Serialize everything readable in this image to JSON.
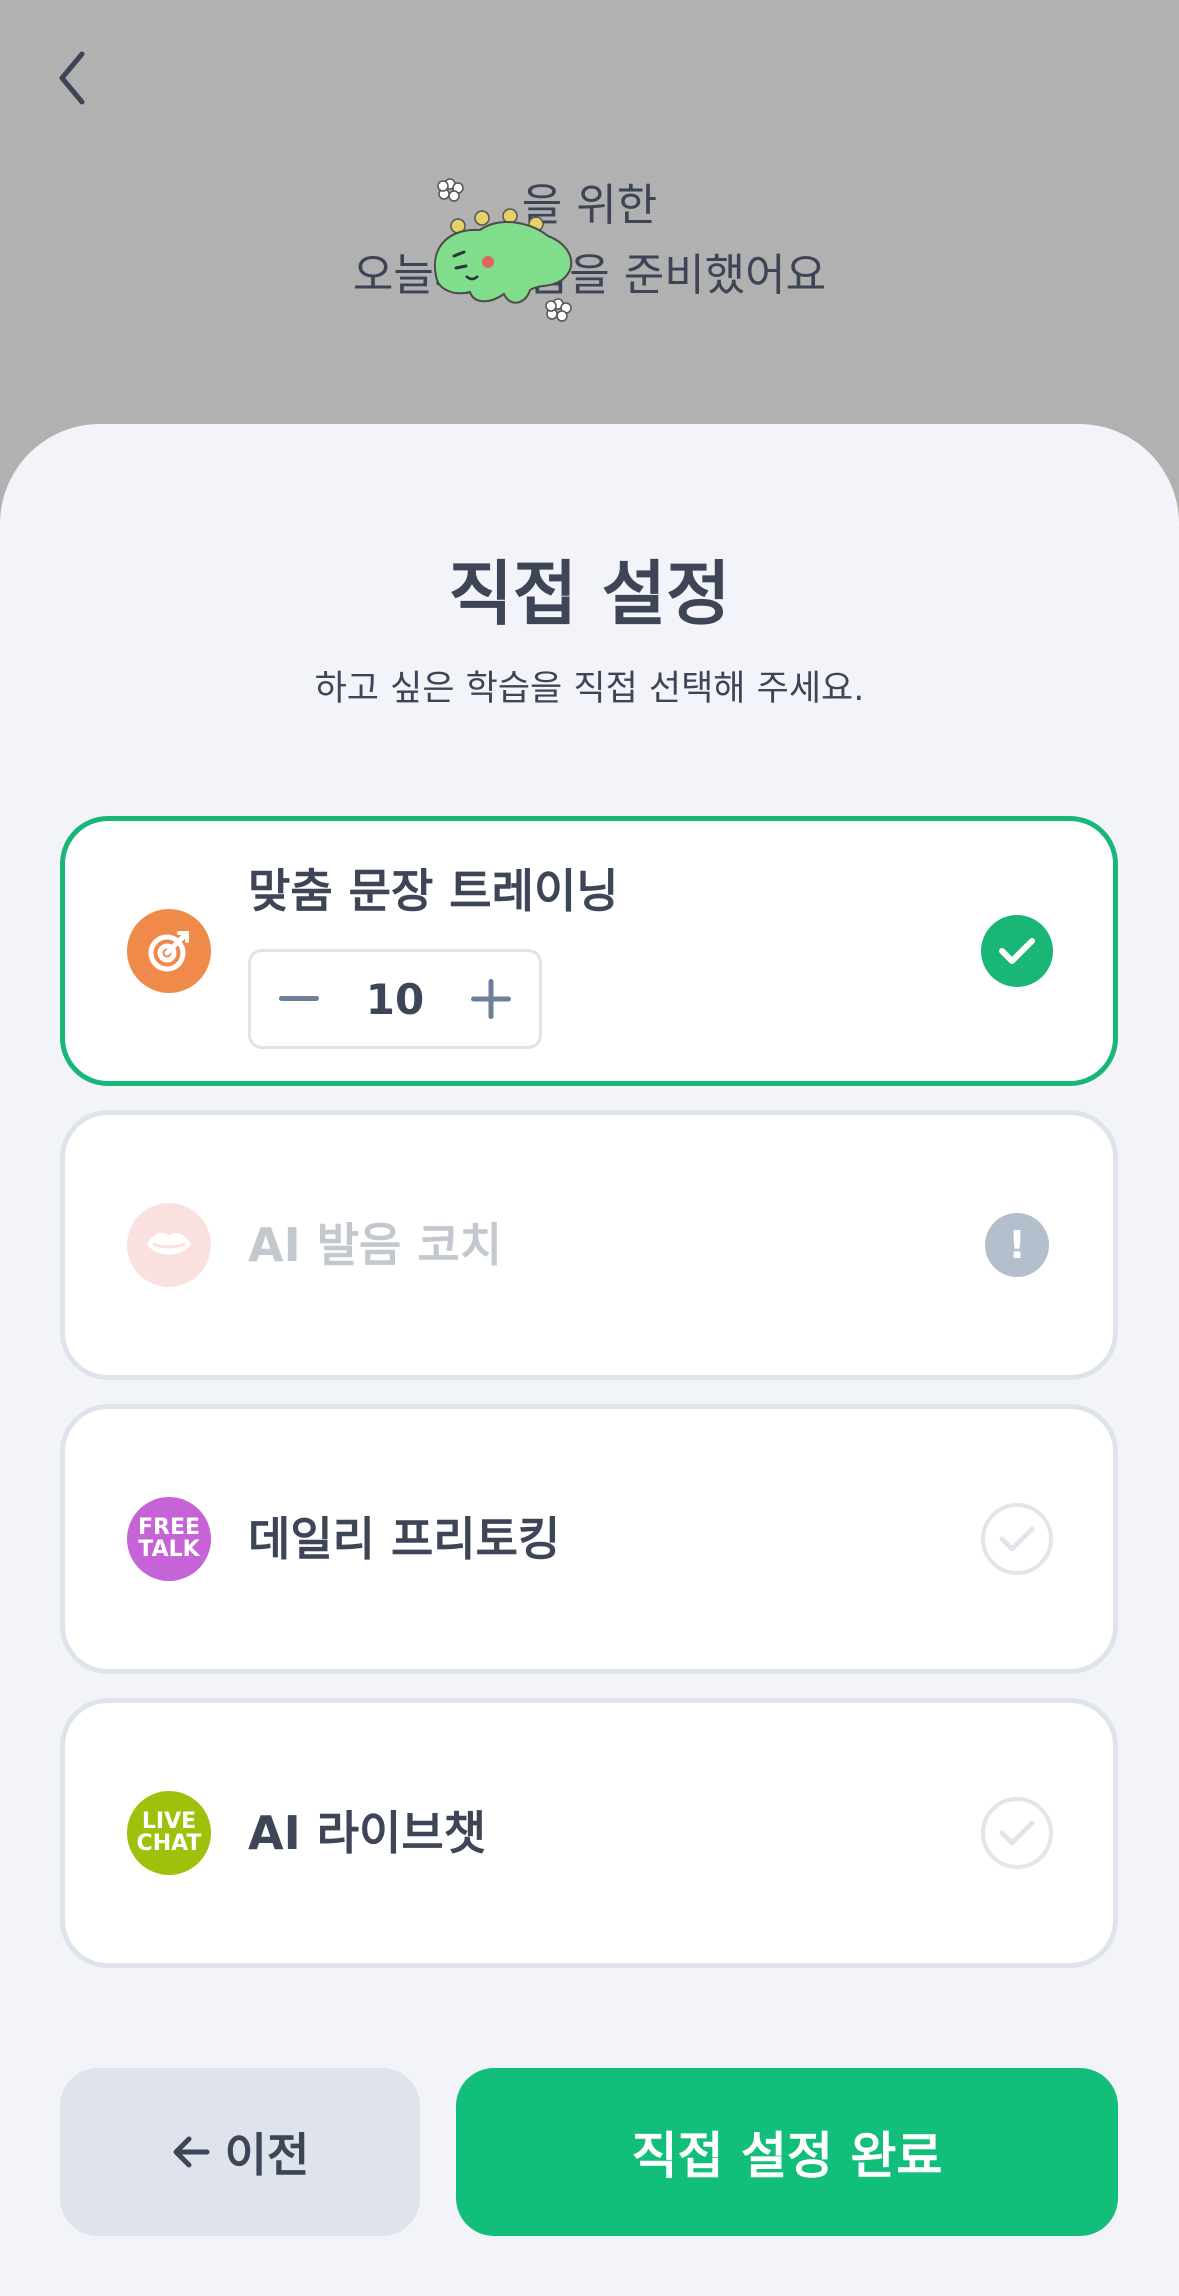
{
  "header": {
    "line1": "을 위한",
    "line2": "오늘의 학습을 준비했어요"
  },
  "sheet": {
    "title": "직접 설정",
    "subtitle": "하고 싶은 학습을 직접 선택해 주세요."
  },
  "items": [
    {
      "label": "맞춤 문장 트레이닝",
      "icon": "target-icon",
      "icon_color": "#f08a4b",
      "state": "selected",
      "count": "10"
    },
    {
      "label": "AI 발음 코치",
      "icon": "lips-icon",
      "icon_color": "#fbe0e0",
      "state": "disabled",
      "warning": "!"
    },
    {
      "label": "데일리 프리토킹",
      "icon": "free-talk-icon",
      "icon_color": "#c663d6",
      "icon_text": [
        "FREE",
        "TALK"
      ],
      "state": "unchecked"
    },
    {
      "label": "AI 라이브챗",
      "icon": "live-chat-icon",
      "icon_color": "#9ec20b",
      "icon_text": [
        "LIVE",
        "CHAT"
      ],
      "state": "unchecked"
    }
  ],
  "buttons": {
    "prev": "이전",
    "done": "직접 설정 완료"
  },
  "colors": {
    "accent": "#12bf7a",
    "text": "#3d4557",
    "border": "#dfe3ec"
  }
}
